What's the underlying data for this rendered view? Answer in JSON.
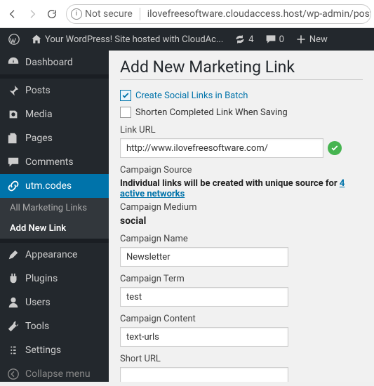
{
  "browser": {
    "not_secure_label": "Not secure",
    "url": "ilovefreesoftware.cloudaccess.host/wp-admin/post-ne"
  },
  "adminbar": {
    "site_name": "Your WordPress! Site hosted with CloudAc...",
    "updates_count": "4",
    "comments_count": "0",
    "new_label": "New"
  },
  "sidebar": {
    "items": [
      {
        "key": "dashboard",
        "label": "Dashboard"
      },
      {
        "key": "posts",
        "label": "Posts"
      },
      {
        "key": "media",
        "label": "Media"
      },
      {
        "key": "pages",
        "label": "Pages"
      },
      {
        "key": "comments",
        "label": "Comments"
      },
      {
        "key": "utm",
        "label": "utm.codes"
      },
      {
        "key": "appearance",
        "label": "Appearance"
      },
      {
        "key": "plugins",
        "label": "Plugins"
      },
      {
        "key": "users",
        "label": "Users"
      },
      {
        "key": "tools",
        "label": "Tools"
      },
      {
        "key": "settings",
        "label": "Settings"
      },
      {
        "key": "collapse",
        "label": "Collapse menu"
      }
    ],
    "submenu": {
      "all_links": "All Marketing Links",
      "add_new": "Add New Link"
    }
  },
  "page": {
    "title": "Add New Marketing Link",
    "chk_batch": "Create Social Links in Batch",
    "chk_shorten": "Shorten Completed Link When Saving",
    "link_url_label": "Link URL",
    "link_url_value": "http://www.ilovefreesoftware.com/",
    "campaign_source_label": "Campaign Source",
    "source_note_prefix": "Individual links will be created with unique source for ",
    "source_note_link": "4 active networks",
    "campaign_medium_label": "Campaign Medium",
    "campaign_medium_value": "social",
    "campaign_name_label": "Campaign Name",
    "campaign_name_value": "Newsletter",
    "campaign_term_label": "Campaign Term",
    "campaign_term_value": "test",
    "campaign_content_label": "Campaign Content",
    "campaign_content_value": "text-urls",
    "short_url_label": "Short URL"
  }
}
